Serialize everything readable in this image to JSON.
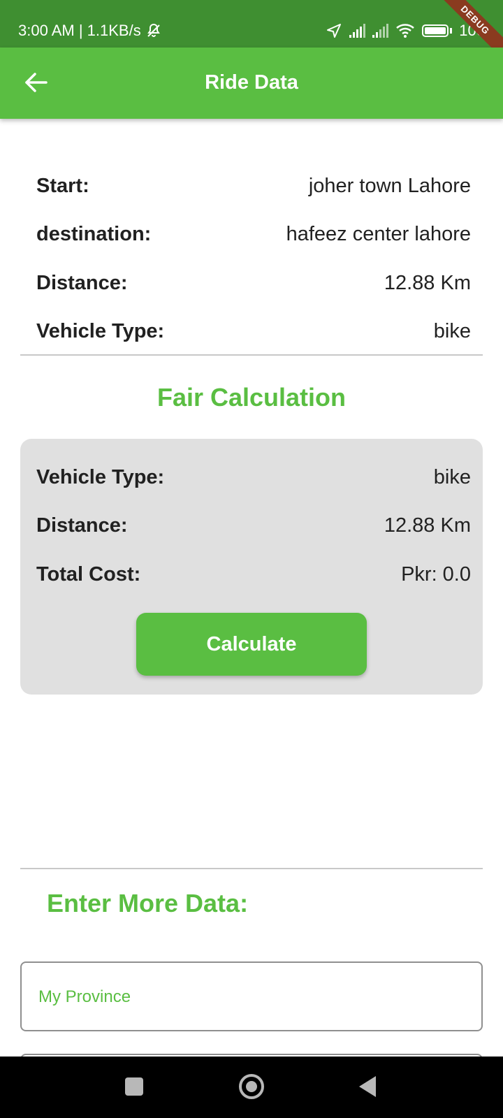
{
  "status_bar": {
    "time_net": "3:00 AM | 1.1KB/s",
    "battery": "100",
    "debug_banner": "DEBUG"
  },
  "app_bar": {
    "title": "Ride Data",
    "back_icon": "arrow-left-icon"
  },
  "ride_info": {
    "start_label": "Start:",
    "start_value": "joher town Lahore",
    "destination_label": "destination:",
    "destination_value": "hafeez center lahore",
    "distance_label": "Distance:",
    "distance_value": "12.88 Km",
    "vehicle_label": "Vehicle Type:",
    "vehicle_value": "bike"
  },
  "fair": {
    "title": "Fair Calculation",
    "vehicle_label": "Vehicle Type:",
    "vehicle_value": "bike",
    "distance_label": "Distance:",
    "distance_value": "12.88 Km",
    "cost_label": "Total Cost:",
    "cost_value": "Pkr: 0.0",
    "calculate_button": "Calculate"
  },
  "more": {
    "title": "Enter More Data:",
    "province_placeholder": "My Province",
    "province_value": ""
  },
  "colors": {
    "primary": "#5abe42",
    "status_bar": "#3f8f31",
    "card": "#e0e0e0"
  }
}
